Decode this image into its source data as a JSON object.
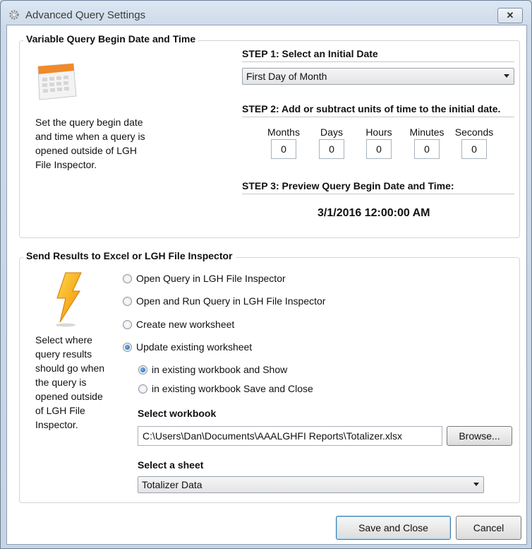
{
  "window": {
    "title": "Advanced Query Settings",
    "close_glyph": "✕"
  },
  "query_group": {
    "title": "Variable Query Begin Date and Time",
    "icon": "calendar-icon",
    "description_lines": [
      "Set the query begin date",
      "and time when a query is",
      "opened outside of LGH",
      "File Inspector."
    ],
    "step1_label": "STEP 1: Select an Initial Date",
    "initial_date_value": "First Day of Month",
    "step2_label": "STEP 2: Add or subtract units of time to the initial date.",
    "units": [
      {
        "label": "Months",
        "value": "0"
      },
      {
        "label": "Days",
        "value": "0"
      },
      {
        "label": "Hours",
        "value": "0"
      },
      {
        "label": "Minutes",
        "value": "0"
      },
      {
        "label": "Seconds",
        "value": "0"
      }
    ],
    "step3_label": "STEP 3: Preview Query Begin Date and Time:",
    "preview_value": "3/1/2016 12:00:00 AM"
  },
  "results_group": {
    "title": "Send Results to Excel or LGH File Inspector",
    "icon": "lightning-icon",
    "description_lines": [
      "Select where",
      "query results",
      "should go when",
      "the query is",
      "opened outside",
      "of LGH File",
      "Inspector."
    ],
    "options": [
      {
        "label": "Open Query in LGH File Inspector",
        "checked": false
      },
      {
        "label": "Open and Run Query in LGH File Inspector",
        "checked": false
      },
      {
        "label": "Create new worksheet",
        "checked": false
      },
      {
        "label": "Update existing worksheet",
        "checked": true
      }
    ],
    "sub_options": [
      {
        "label": "in existing workbook and Show",
        "checked": true
      },
      {
        "label": "in existing workbook Save and Close",
        "checked": false
      }
    ],
    "workbook_label": "Select workbook",
    "workbook_path": "C:\\Users\\Dan\\Documents\\AAALGHFI Reports\\Totalizer.xlsx",
    "browse_label": "Browse...",
    "sheet_label": "Select a sheet",
    "sheet_value": "Totalizer Data"
  },
  "footer": {
    "save_label": "Save and Close",
    "cancel_label": "Cancel"
  },
  "colors": {
    "accent": "#1e5fa8",
    "lightning": "#f5b400",
    "calendar_header": "#f08a2a"
  }
}
